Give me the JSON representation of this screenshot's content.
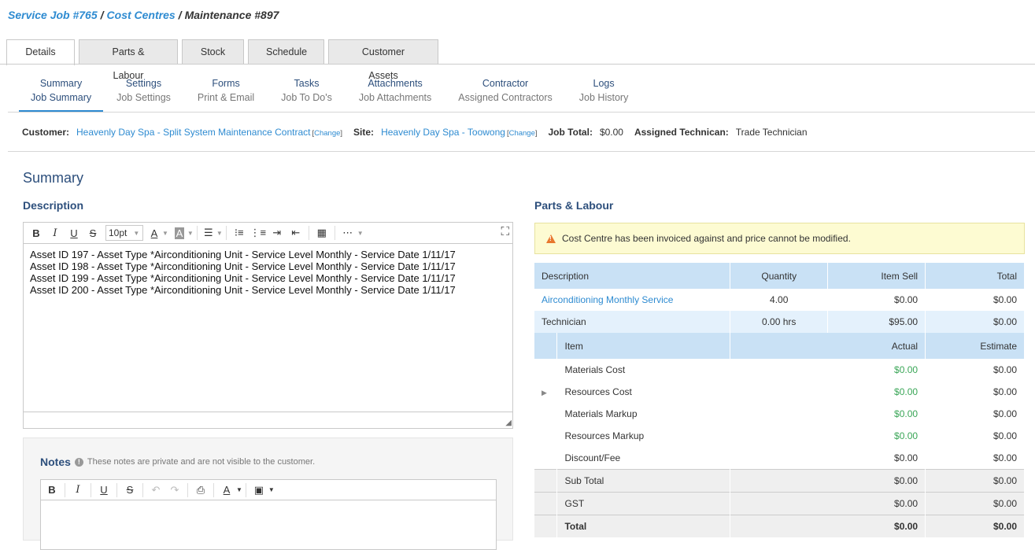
{
  "breadcrumb": {
    "items": [
      "Service Job #765",
      "Cost Centres"
    ],
    "current": "Maintenance #897",
    "separator": "/"
  },
  "tabs": [
    "Details",
    "Parts & Labour",
    "Stock",
    "Schedule",
    "Customer Assets"
  ],
  "subnav": [
    {
      "top": "Summary",
      "bottom": "Job Summary"
    },
    {
      "top": "Settings",
      "bottom": "Job Settings"
    },
    {
      "top": "Forms",
      "bottom": "Print & Email"
    },
    {
      "top": "Tasks",
      "bottom": "Job To Do's"
    },
    {
      "top": "Attachments",
      "bottom": "Job Attachments"
    },
    {
      "top": "Contractor",
      "bottom": "Assigned Contractors"
    },
    {
      "top": "Logs",
      "bottom": "Job History"
    }
  ],
  "info": {
    "customer_label": "Customer:",
    "customer_value": "Heavenly Day Spa - Split System Maintenance Contract",
    "change_label": "Change",
    "site_label": "Site:",
    "site_value": "Heavenly Day Spa - Toowong",
    "job_total_label": "Job Total:",
    "job_total_value": "$0.00",
    "technician_label": "Assigned Technican:",
    "technician_value": "Trade Technician"
  },
  "summary_title": "Summary",
  "description": {
    "heading": "Description",
    "font_size": "10pt",
    "lines": [
      "Asset ID 197 - Asset Type *Airconditioning Unit - Service Level Monthly - Service Date 1/11/17",
      "Asset ID 198 - Asset Type *Airconditioning Unit - Service Level Monthly - Service Date 1/11/17",
      "Asset ID 199 - Asset Type *Airconditioning Unit - Service Level Monthly - Service Date 1/11/17",
      "Asset ID 200 - Asset Type *Airconditioning Unit - Service Level Monthly - Service Date 1/11/17"
    ]
  },
  "notes": {
    "heading": "Notes",
    "hint": "These notes are private and are not visible to the customer."
  },
  "parts_labour": {
    "heading": "Parts & Labour",
    "warning": "Cost Centre has been invoiced against and price cannot be modified.",
    "columns": [
      "Description",
      "Quantity",
      "Item Sell",
      "Total"
    ],
    "rows": [
      {
        "description": "Airconditioning Monthly Service",
        "quantity": "4.00",
        "item_sell": "$0.00",
        "total": "$0.00"
      },
      {
        "description": "Technician",
        "quantity": "0.00 hrs",
        "item_sell": "$95.00",
        "total": "$0.00"
      }
    ],
    "cost_columns": [
      "Item",
      "Actual",
      "Estimate"
    ],
    "costs": [
      {
        "item": "Materials Cost",
        "actual": "$0.00",
        "estimate": "$0.00"
      },
      {
        "item": "Resources Cost",
        "actual": "$0.00",
        "estimate": "$0.00"
      },
      {
        "item": "Materials Markup",
        "actual": "$0.00",
        "estimate": "$0.00"
      },
      {
        "item": "Resources Markup",
        "actual": "$0.00",
        "estimate": "$0.00"
      },
      {
        "item": "Discount/Fee",
        "actual": "$0.00",
        "estimate": "$0.00"
      }
    ],
    "totals": [
      {
        "item": "Sub Total",
        "actual": "$0.00",
        "estimate": "$0.00"
      },
      {
        "item": "GST",
        "actual": "$0.00",
        "estimate": "$0.00"
      },
      {
        "item": "Total",
        "actual": "$0.00",
        "estimate": "$0.00"
      }
    ]
  },
  "colors": {
    "link": "#2e8bd1",
    "heading": "#2d4f7c",
    "table_header": "#c9e1f5",
    "actual_green": "#3aa657",
    "warning_bg": "#fdfbd2"
  }
}
